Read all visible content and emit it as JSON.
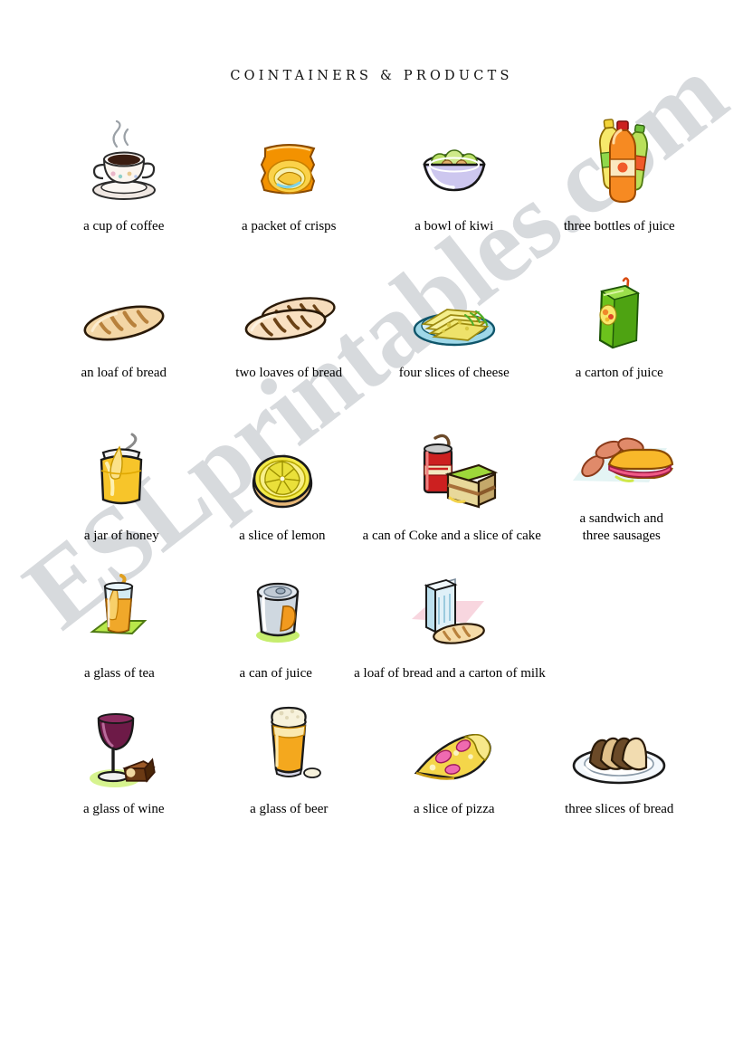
{
  "document": {
    "title": "COINTAINERS & PRODUCTS",
    "watermark": "ESLprintables.com"
  },
  "rows": [
    {
      "items": [
        {
          "label": "a cup of coffee",
          "art": "coffee-cup"
        },
        {
          "label": "a packet of crisps",
          "art": "crisps-packet"
        },
        {
          "label": "a bowl of kiwi",
          "art": "bowl-of-kiwi"
        },
        {
          "label": "three bottles of juice",
          "art": "juice-bottles"
        }
      ]
    },
    {
      "items": [
        {
          "label": "an loaf of bread",
          "art": "loaf-of-bread"
        },
        {
          "label": "two loaves of bread",
          "art": "two-loaves-of-bread"
        },
        {
          "label": "four slices of cheese",
          "art": "cheese-slices"
        },
        {
          "label": "a carton of juice",
          "art": "juice-carton"
        }
      ]
    },
    {
      "items": [
        {
          "label": "a jar of honey",
          "art": "honey-jar"
        },
        {
          "label": "a slice of lemon",
          "art": "lemon-slice"
        },
        {
          "label": "a can of Coke and a slice of cake",
          "art": "coke-can-and-cake"
        },
        {
          "label": "a sandwich and three sausages",
          "art": "sandwich-and-sausages"
        }
      ]
    },
    {
      "items": [
        {
          "label": "a glass of tea",
          "art": "glass-of-tea"
        },
        {
          "label": "a can of juice",
          "art": "juice-can"
        },
        {
          "label": "a loaf of bread and a carton of milk",
          "art": "bread-and-milk-carton"
        },
        {
          "label": "",
          "art": "none"
        }
      ]
    },
    {
      "items": [
        {
          "label": "a glass of wine",
          "art": "wine-glass"
        },
        {
          "label": "a glass of beer",
          "art": "beer-glass"
        },
        {
          "label": "a slice of pizza",
          "art": "pizza-slice"
        },
        {
          "label": "three slices of bread",
          "art": "bread-slices-plate"
        }
      ]
    }
  ],
  "colors": {
    "watermark": "#c9ccd1",
    "coffee": "#3a1c10",
    "crisps": "#f39200",
    "kiwi": "#9bd14a",
    "bottle_orange": "#f07d16",
    "bread": "#f0cfa0",
    "cheese": "#f2e46a",
    "carton_green": "#5cc02a",
    "honey": "#f5b41a",
    "lemon": "#f3e03c",
    "coke_red": "#cc1f1f",
    "sausage": "#e0896d",
    "tea": "#e8a020",
    "milk_blue": "#cfe9f5",
    "wine": "#6d1a47",
    "beer": "#f0a81e",
    "pizza": "#f2d24b"
  }
}
